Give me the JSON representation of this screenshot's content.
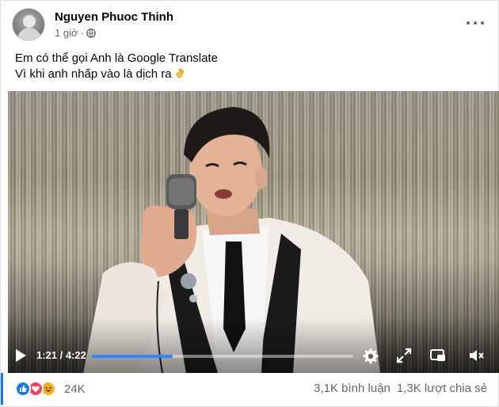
{
  "post": {
    "author": "Nguyen Phuoc Thinh",
    "time": "1 giờ",
    "separator": "·",
    "privacy_icon": "globe-icon",
    "more_icon": "more-options-icon",
    "caption_lines": [
      "Em có thể gọi Anh là Google Translate",
      "Vì khi anh nhấp vào là dịch ra"
    ],
    "caption_emoji": "hand-emoji"
  },
  "video": {
    "current_time": "1:21",
    "time_separator": " / ",
    "duration": "4:22",
    "progress_fraction": 0.309,
    "progress_color": "#2d88ff",
    "icons": [
      "play-icon",
      "settings-icon",
      "fullscreen-expand-icon",
      "picture-in-picture-icon",
      "volume-muted-icon"
    ]
  },
  "footer": {
    "reactions": [
      "like",
      "love",
      "haha"
    ],
    "reaction_count": "24K",
    "comments": "3,1K bình luận",
    "shares": "1,3K lượt chia sẻ"
  },
  "colors": {
    "accent": "#1877f2",
    "secondary_text": "#65676b"
  }
}
